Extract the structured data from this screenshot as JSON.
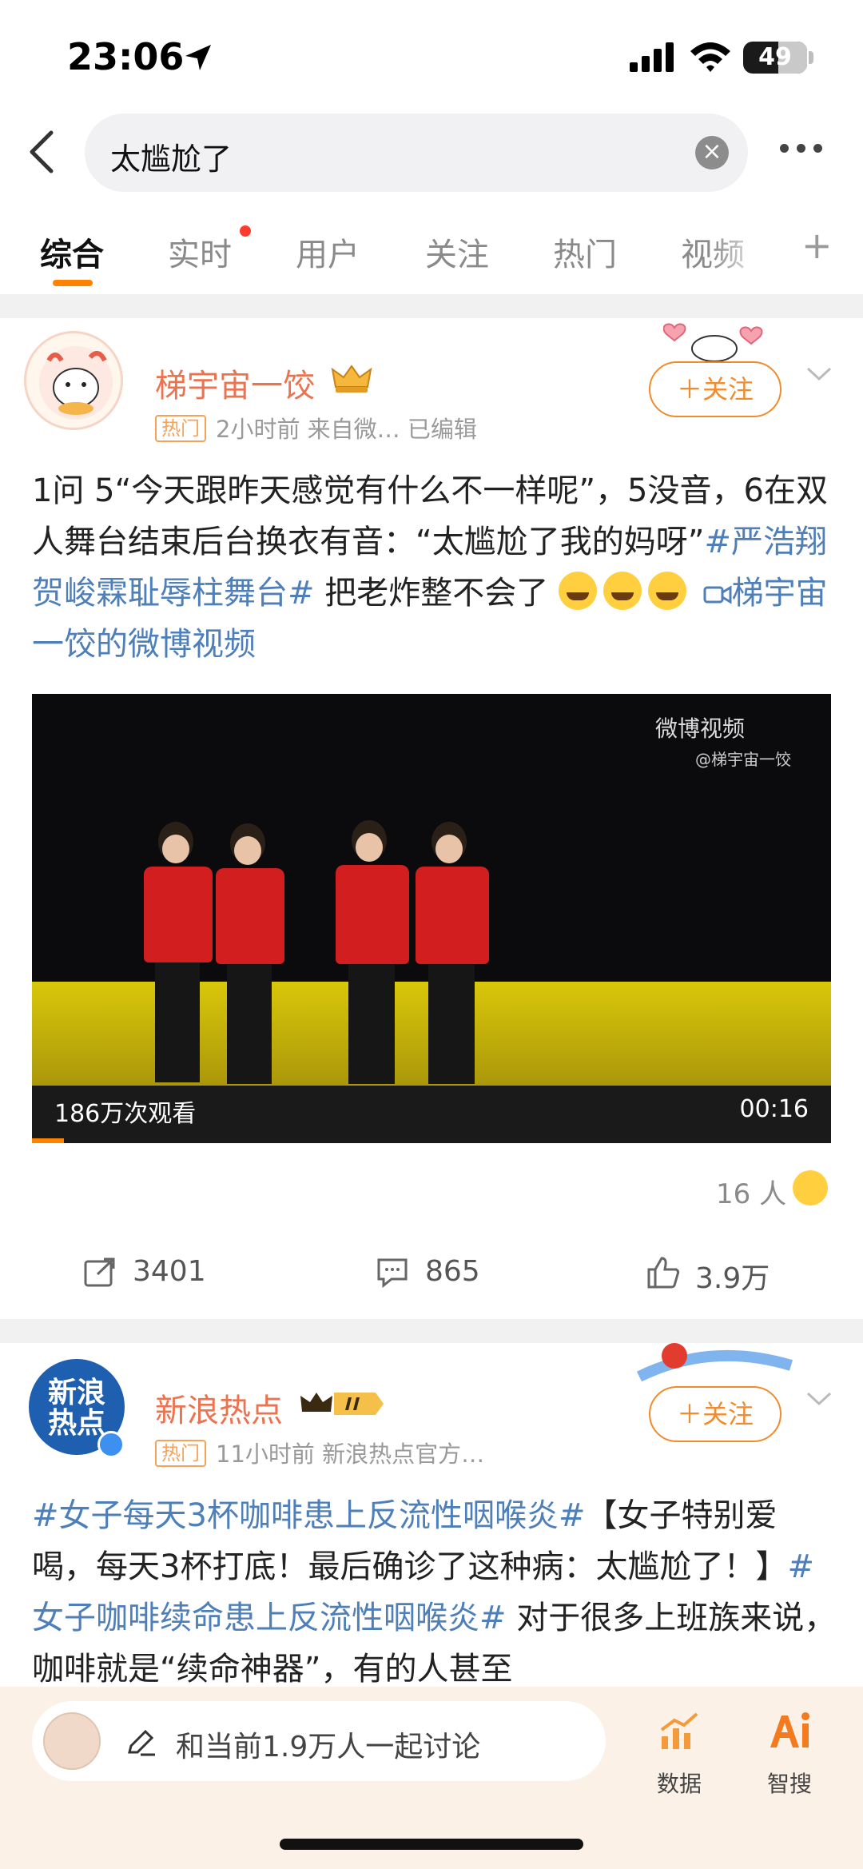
{
  "status_bar": {
    "time": "23:06",
    "battery": "49"
  },
  "search": {
    "query": "太尴尬了",
    "clear_icon": "×"
  },
  "tabs": [
    {
      "label": "综合",
      "active": true
    },
    {
      "label": "实时",
      "has_dot": true
    },
    {
      "label": "用户"
    },
    {
      "label": "关注"
    },
    {
      "label": "热门"
    },
    {
      "label": "视频"
    }
  ],
  "tabs_plus": "+",
  "posts": [
    {
      "author": "梯宇宙一饺",
      "hot_badge": "热门",
      "meta": "2小时前  来自微…  已编辑",
      "follow_label": "＋关注",
      "text_1": "1问 5“今天跟昨天感觉有什么不一样呢”，5没音，6在双人舞台结束后台换衣有音：“太尴尬了我的妈呀”",
      "topic": "#严浩翔贺峻霖耻辱柱舞台#",
      "text_2": " 把老炸整不会了",
      "video_link": "梯宇宙一饺的微博视频",
      "video": {
        "views": "186万次观看",
        "duration": "00:16",
        "watermark": "微博视频",
        "watermark_sub": "@梯宇宙一饺"
      },
      "reactors": "16 人",
      "actions": {
        "repost": "3401",
        "comment": "865",
        "like": "3.9万"
      }
    },
    {
      "author": "新浪热点",
      "hot_badge": "热门",
      "meta": "11小时前  新浪热点官方…",
      "follow_label": "＋关注",
      "avatar_text": "新浪热点",
      "topic_1": "#女子每天3杯咖啡患上反流性咽喉炎#",
      "text_1": "【女子特别爱喝，每天3杯打底！最后确诊了这种病：太尴尬了！】",
      "topic_2": "#女子咖啡续命患上反流性咽喉炎#",
      "text_2": " 对于很多上班族来说，咖啡就是“续命神器”，有的人甚至"
    }
  ],
  "bottom_bar": {
    "discuss_placeholder": "和当前1.9万人一起讨论",
    "tools": [
      {
        "label": "数据"
      },
      {
        "label": "智搜"
      }
    ]
  },
  "colors": {
    "accent": "#ff8200",
    "name": "#eb7350",
    "link": "#4e7fb9"
  }
}
